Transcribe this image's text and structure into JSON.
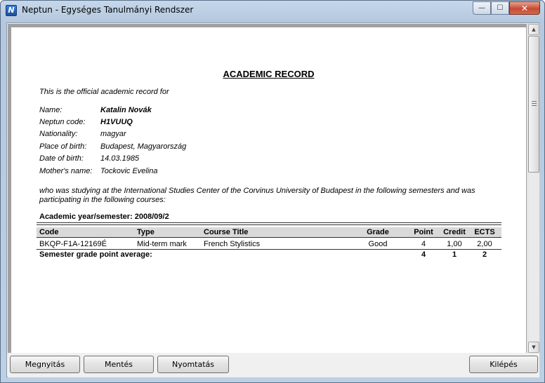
{
  "window": {
    "title": "Neptun - Egységes Tanulmányi Rendszer",
    "icon_letter": "N",
    "controls": {
      "minimize": "—",
      "maximize": "☐",
      "close": "✕"
    }
  },
  "document": {
    "title": "ACADEMIC RECORD",
    "intro": "This is the official academic record for",
    "fields": [
      {
        "label": "Name:",
        "value": "Katalin Novák"
      },
      {
        "label": "Neptun code:",
        "value": "H1VUUQ"
      },
      {
        "label": "Nationality:",
        "value": "magyar"
      },
      {
        "label": "Place of birth:",
        "value": "Budapest, Magyarország"
      },
      {
        "label": "Date of birth:",
        "value": "14.03.1985"
      },
      {
        "label": "Mother's name:",
        "value": "Tockovic Evelina"
      }
    ],
    "paragraph": "who was studying at the International Studies Center of the Corvinus University of Budapest in the following semesters and was participating in the following courses:",
    "semester_heading": "Academic year/semester: 2008/09/2",
    "table": {
      "columns": [
        "Code",
        "Type",
        "Course Title",
        "Grade",
        "Point",
        "Credit",
        "ECTS"
      ],
      "rows": [
        [
          "BKQP-F1A-12169É",
          "Mid-term mark",
          "French Stylistics",
          "Good",
          "4",
          "1,00",
          "2,00"
        ]
      ],
      "footer": {
        "label": "Semester grade point average:",
        "point": "4",
        "credit": "1",
        "ects": "2"
      }
    }
  },
  "scrollbar": {
    "up_arrow": "▲",
    "down_arrow": "▼"
  },
  "buttons": {
    "open": "Megnyitás",
    "save": "Mentés",
    "print": "Nyomtatás",
    "exit": "Kilépés"
  }
}
